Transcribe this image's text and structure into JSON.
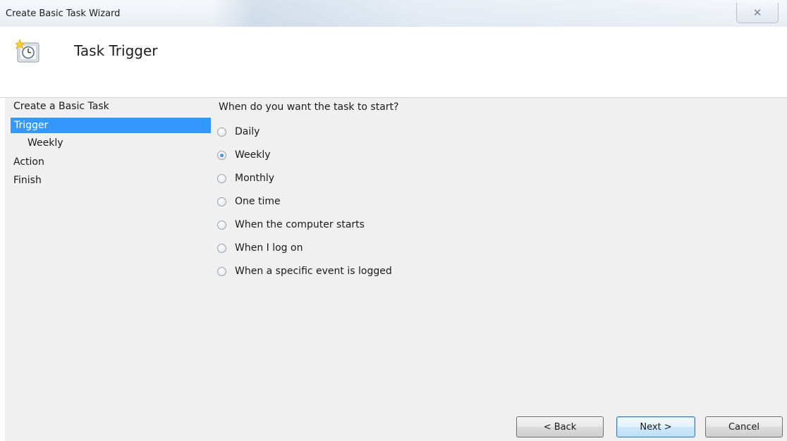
{
  "window": {
    "title": "Create Basic Task Wizard",
    "close_glyph": "✕"
  },
  "header": {
    "title": "Task Trigger",
    "icon": "task-scheduler-clock-icon"
  },
  "nav": {
    "items": [
      {
        "label": "Create a Basic Task",
        "selected": false
      },
      {
        "label": "Trigger",
        "selected": true
      },
      {
        "label": "Weekly",
        "selected": false
      },
      {
        "label": "Action",
        "selected": false
      },
      {
        "label": "Finish",
        "selected": false
      }
    ]
  },
  "content": {
    "question": "When do you want the task to start?",
    "options": [
      {
        "label": "Daily",
        "checked": false
      },
      {
        "label": "Weekly",
        "checked": true
      },
      {
        "label": "Monthly",
        "checked": false
      },
      {
        "label": "One time",
        "checked": false
      },
      {
        "label": "When the computer starts",
        "checked": false
      },
      {
        "label": "When I log on",
        "checked": false
      },
      {
        "label": "When a specific event is logged",
        "checked": false
      }
    ]
  },
  "buttons": {
    "back_label": "< Back",
    "next_label": "Next >",
    "cancel_label": "Cancel"
  },
  "colors": {
    "selection": "#3399ff",
    "panel_background": "#f0f0f0"
  }
}
